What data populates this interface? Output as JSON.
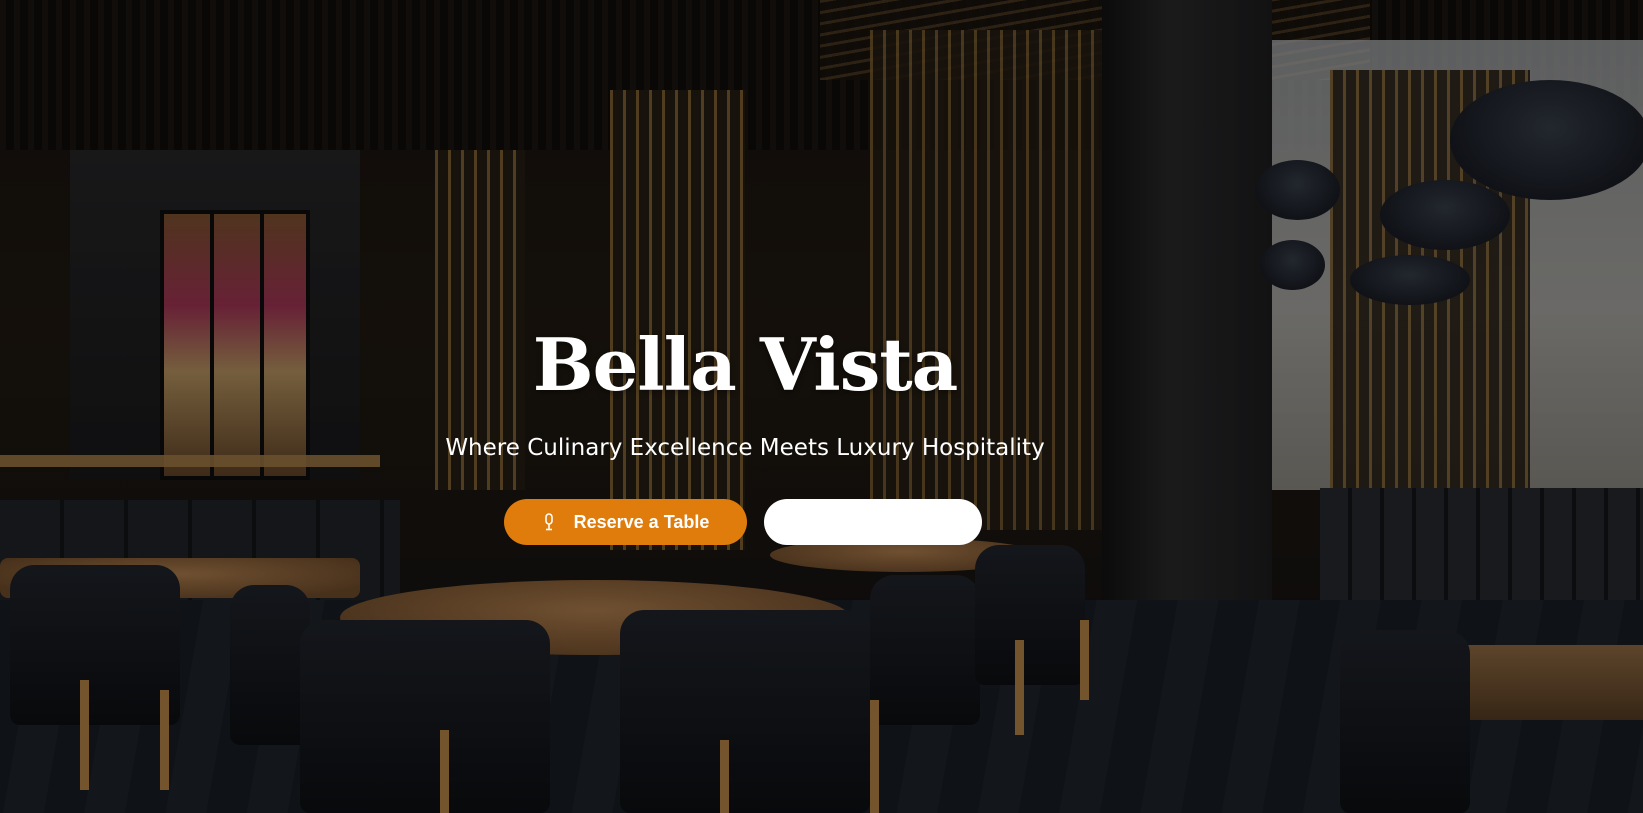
{
  "hero": {
    "title": "Bella Vista",
    "tagline": "Where Culinary Excellence Meets Luxury Hospitality"
  },
  "actions": {
    "reserve": {
      "label": "Reserve a Table",
      "icon": "microphone-icon"
    },
    "secondary": {
      "label": ""
    }
  },
  "colors": {
    "accent": "#df7c0c",
    "text": "#ffffff",
    "secondary_button": "#ffffff"
  }
}
